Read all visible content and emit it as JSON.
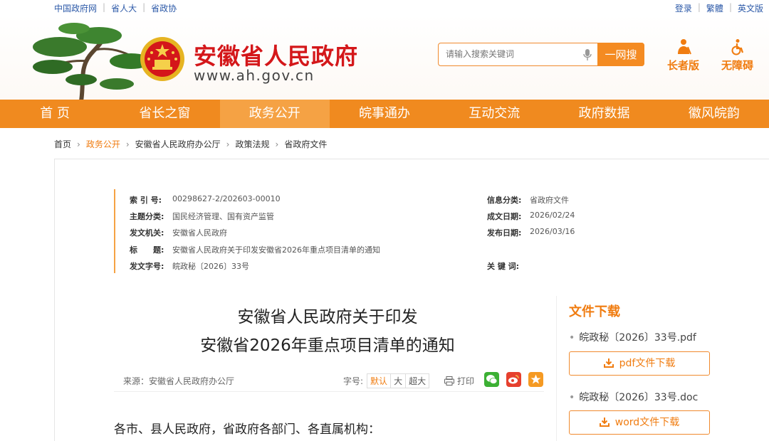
{
  "toplinks": {
    "left": [
      "中国政府网",
      "省人大",
      "省政协"
    ],
    "right": [
      "登录",
      "繁體",
      "英文版"
    ]
  },
  "site": {
    "name": "安徽省人民政府",
    "url": "www.ah.gov.cn"
  },
  "search": {
    "placeholder": "请输入搜索关键词",
    "button": "一网搜"
  },
  "modes": {
    "elder": "长者版",
    "accessible": "无障碍"
  },
  "nav": [
    "首 页",
    "省长之窗",
    "政务公开",
    "皖事通办",
    "互动交流",
    "政府数据",
    "徽风皖韵"
  ],
  "nav_active_index": 2,
  "breadcrumb": [
    "首页",
    "政务公开",
    "安徽省人民政府办公厅",
    "政策法规",
    "省政府文件"
  ],
  "meta": {
    "index_k": "索 引 号:",
    "index_v": "00298627-2/202603-00010",
    "category_k": "主题分类:",
    "category_v": "国民经济管理、国有资产监管",
    "issuer_k": "发文机关:",
    "issuer_v": "安徽省人民政府",
    "title_k": "标　　题:",
    "title_v": "安徽省人民政府关于印发安徽省2026年重点项目清单的通知",
    "docno_k": "发文字号:",
    "docno_v": "皖政秘〔2026〕33号",
    "infocat_k": "信息分类:",
    "infocat_v": "省政府文件",
    "created_k": "成文日期:",
    "created_v": "2026/02/24",
    "published_k": "发布日期:",
    "published_v": "2026/03/16",
    "keywords_k": "关 键 词:",
    "keywords_v": ""
  },
  "article": {
    "title_line1": "安徽省人民政府关于印发",
    "title_line2": "安徽省2026年重点项目清单的通知",
    "source": "来源：安徽省人民政府办公厅",
    "fontsize_label": "字号:",
    "fontsize_options": [
      "默认",
      "大",
      "超大"
    ],
    "print": "打印",
    "salutation": "各市、县人民政府，省政府各部门、各直属机构："
  },
  "downloads": {
    "heading": "文件下载",
    "files": [
      {
        "name": "皖政秘〔2026〕33号.pdf",
        "button": "pdf文件下载"
      },
      {
        "name": "皖政秘〔2026〕33号.doc",
        "button": "word文件下载"
      }
    ]
  },
  "colors": {
    "brand_orange": "#f08a1f",
    "title_red": "#d4171a",
    "wechat": "#3cb034",
    "weibo": "#e6402e",
    "favorite": "#f59a23"
  }
}
